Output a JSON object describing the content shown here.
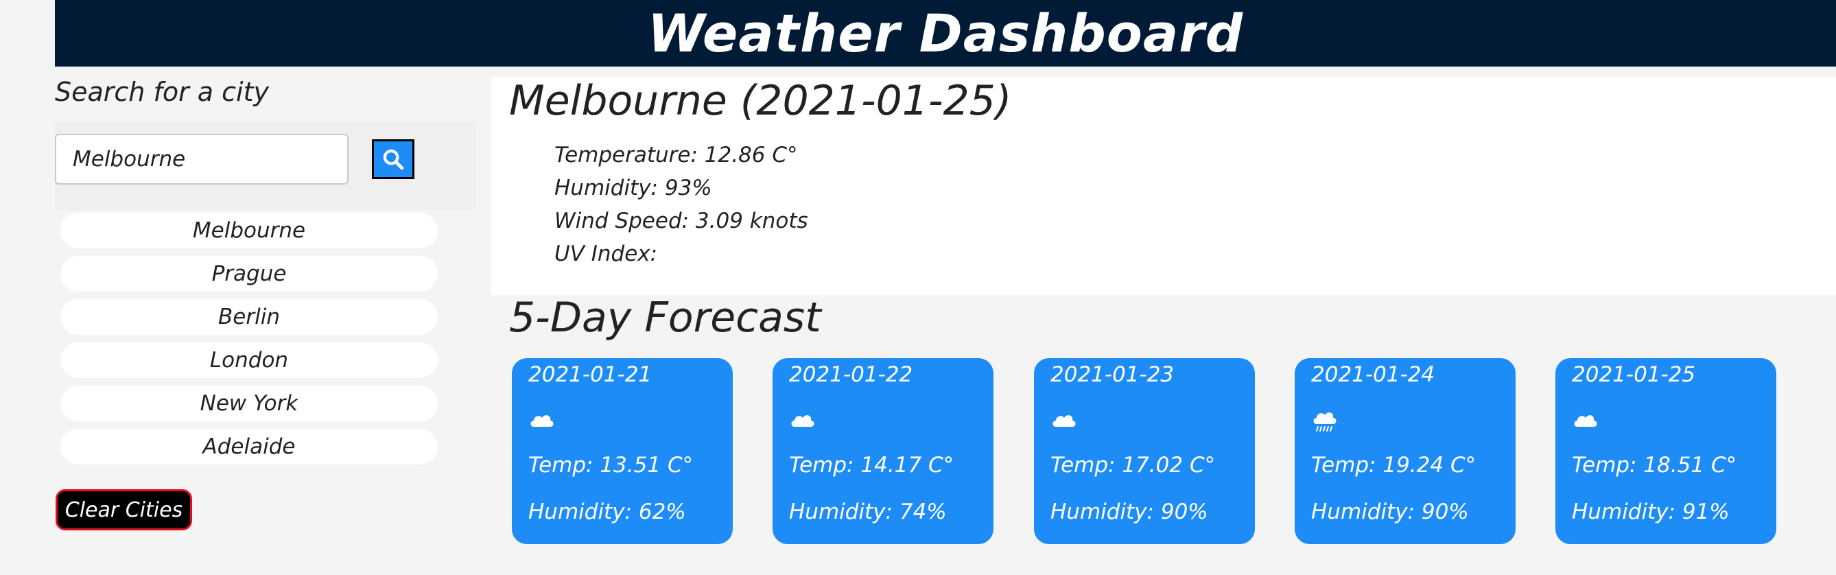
{
  "header": {
    "title": "Weather Dashboard"
  },
  "sidebar": {
    "title": "Search for a city",
    "search": {
      "value": "Melbourne"
    },
    "cities": [
      "Melbourne",
      "Prague",
      "Berlin",
      "London",
      "New York",
      "Adelaide"
    ],
    "clear_label": "Clear Cities"
  },
  "current": {
    "title": "Melbourne (2021-01-25)",
    "temperature": "Temperature: 12.86 C°",
    "humidity": "Humidity: 93%",
    "wind": "Wind Speed: 3.09 knots",
    "uv": "UV Index:"
  },
  "forecast": {
    "title": "5-Day Forecast",
    "days": [
      {
        "date": "2021-01-21",
        "icon": "cloud-icon",
        "temp": "Temp: 13.51 C°",
        "humidity": "Humidity: 62%"
      },
      {
        "date": "2021-01-22",
        "icon": "cloud-icon",
        "temp": "Temp: 14.17 C°",
        "humidity": "Humidity: 74%"
      },
      {
        "date": "2021-01-23",
        "icon": "cloud-icon",
        "temp": "Temp: 17.02 C°",
        "humidity": "Humidity: 90%"
      },
      {
        "date": "2021-01-24",
        "icon": "cloud-rain-icon",
        "temp": "Temp: 19.24 C°",
        "humidity": "Humidity: 90%"
      },
      {
        "date": "2021-01-25",
        "icon": "cloud-icon",
        "temp": "Temp: 18.51 C°",
        "humidity": "Humidity: 91%"
      }
    ]
  },
  "colors": {
    "header_bg": "#011a36",
    "accent": "#1e8cf6",
    "clear_border": "#e01020"
  }
}
